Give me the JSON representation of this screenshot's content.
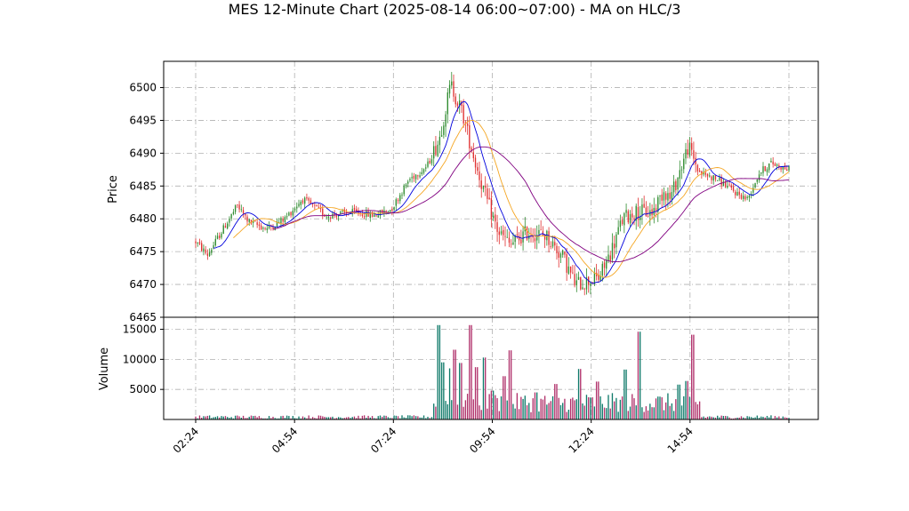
{
  "chart_data": {
    "type": "candlestick",
    "title": "MES 12-Minute Chart (2025-08-14 06:00~07:00) - MA on HLC/3",
    "price_panel": {
      "ylabel": "Price",
      "ylim": [
        6465,
        6504
      ],
      "yticks": [
        6465,
        6470,
        6475,
        6480,
        6485,
        6490,
        6495,
        6500
      ],
      "grid": true
    },
    "volume_panel": {
      "ylabel": "Volume",
      "ylim": [
        0,
        17000
      ],
      "yticks": [
        5000,
        10000,
        15000
      ],
      "grid": true
    },
    "xaxis": {
      "tick_labels": [
        "02:24",
        "04:54",
        "07:24",
        "09:54",
        "12:24",
        "14:54",
        ""
      ],
      "tick_positions": [
        0,
        0.1667,
        0.3333,
        0.5,
        0.6667,
        0.8333,
        1.0
      ]
    },
    "colors": {
      "up": "#2e8b2e",
      "down": "#e03030",
      "vol_up": "#0f7a6a",
      "vol_down": "#b0306a",
      "ma_fast": "#0000dd",
      "ma_mid": "#f5a623",
      "ma_slow": "#800080"
    },
    "price_keypoints": [
      [
        0.0,
        6476.5
      ],
      [
        0.02,
        6474.5
      ],
      [
        0.04,
        6477.5
      ],
      [
        0.07,
        6482
      ],
      [
        0.09,
        6479.5
      ],
      [
        0.12,
        6478.5
      ],
      [
        0.15,
        6480
      ],
      [
        0.18,
        6483
      ],
      [
        0.22,
        6480.5
      ],
      [
        0.27,
        6481
      ],
      [
        0.3,
        6480.5
      ],
      [
        0.33,
        6481.5
      ],
      [
        0.36,
        6486
      ],
      [
        0.39,
        6488
      ],
      [
        0.41,
        6492
      ],
      [
        0.43,
        6500.5
      ],
      [
        0.45,
        6496
      ],
      [
        0.47,
        6489
      ],
      [
        0.49,
        6483
      ],
      [
        0.51,
        6478
      ],
      [
        0.53,
        6476
      ],
      [
        0.56,
        6478
      ],
      [
        0.59,
        6477.5
      ],
      [
        0.62,
        6474
      ],
      [
        0.64,
        6470
      ],
      [
        0.66,
        6470.5
      ],
      [
        0.68,
        6471
      ],
      [
        0.7,
        6475
      ],
      [
        0.72,
        6480
      ],
      [
        0.74,
        6481
      ],
      [
        0.77,
        6481
      ],
      [
        0.79,
        6484.5
      ],
      [
        0.8,
        6483
      ],
      [
        0.83,
        6491
      ],
      [
        0.85,
        6487
      ],
      [
        0.88,
        6486
      ],
      [
        0.91,
        6484
      ],
      [
        0.93,
        6483
      ],
      [
        0.95,
        6487
      ],
      [
        0.97,
        6488.5
      ],
      [
        1.0,
        6487.5
      ]
    ],
    "volume_spikes": [
      [
        0.41,
        15700
      ],
      [
        0.415,
        9500
      ],
      [
        0.428,
        8500
      ],
      [
        0.437,
        11600
      ],
      [
        0.445,
        9400
      ],
      [
        0.463,
        15700
      ],
      [
        0.472,
        8700
      ],
      [
        0.486,
        10300
      ],
      [
        0.5,
        4800
      ],
      [
        0.521,
        7200
      ],
      [
        0.53,
        11500
      ],
      [
        0.575,
        4500
      ],
      [
        0.606,
        5900
      ],
      [
        0.646,
        8400
      ],
      [
        0.676,
        6300
      ],
      [
        0.724,
        8300
      ],
      [
        0.748,
        14600
      ],
      [
        0.815,
        5800
      ],
      [
        0.829,
        6400
      ],
      [
        0.838,
        14100
      ]
    ],
    "n_bars": 300,
    "bar_range_x": [
      0.0,
      1.0
    ],
    "vol_active_range": [
      0.4,
      0.85
    ]
  }
}
